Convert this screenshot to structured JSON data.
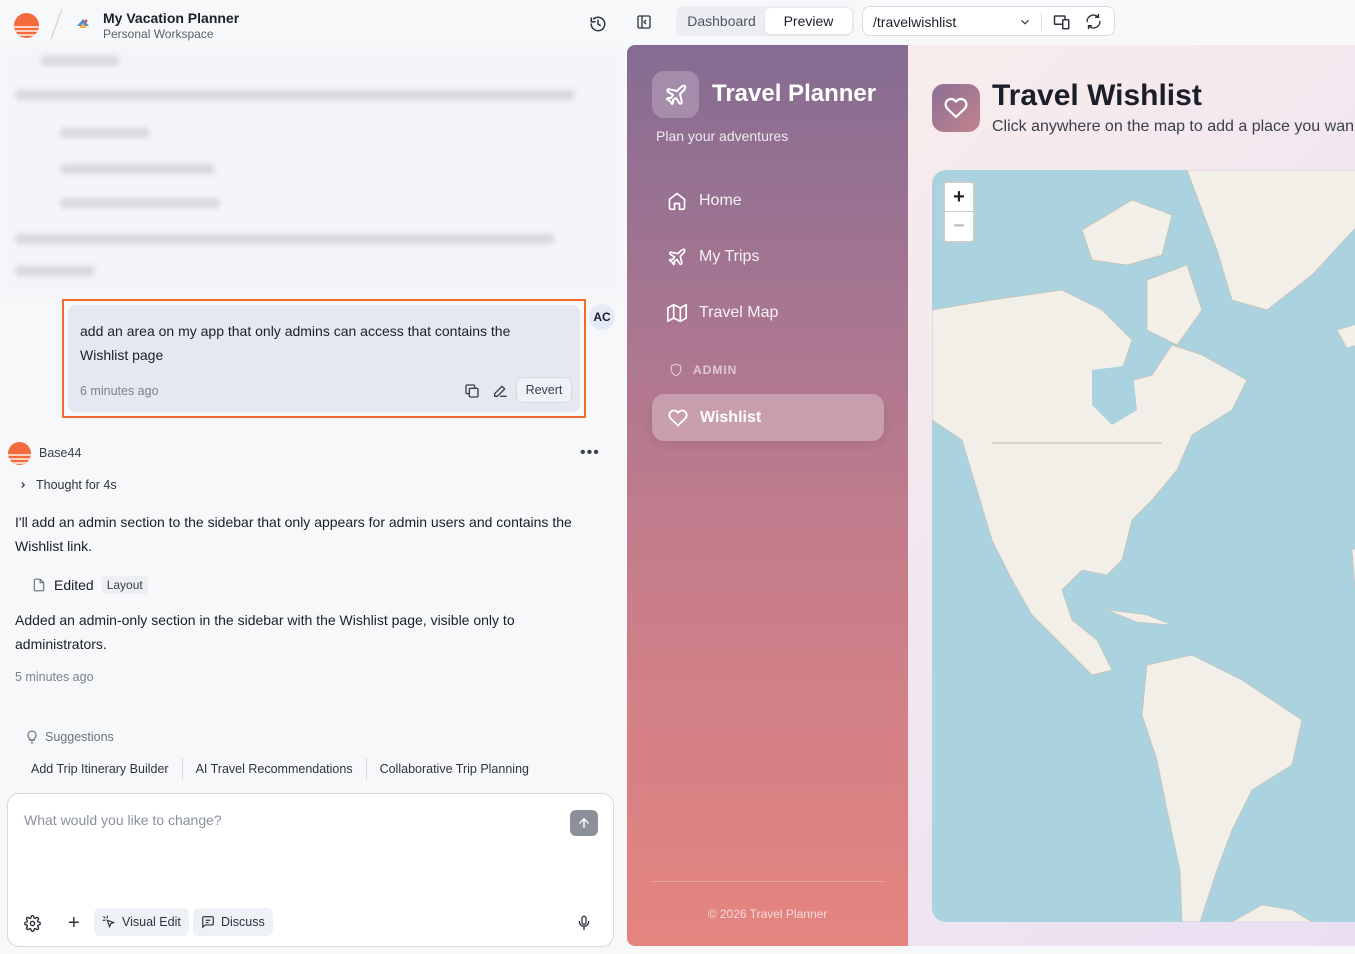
{
  "header": {
    "project_name": "My Vacation Planner",
    "workspace": "Personal Workspace",
    "view_tabs": [
      {
        "label": "Dashboard",
        "active": false
      },
      {
        "label": "Preview",
        "active": true
      }
    ],
    "url_path": "/travelwishlist"
  },
  "chat": {
    "user_message": {
      "avatar_initials": "AC",
      "text": "add an area on my app that only admins can access that contains the Wishlist page",
      "time": "6 minutes ago",
      "revert_label": "Revert"
    },
    "bot_message": {
      "name": "Base44",
      "more_label": "•••",
      "thought_label": "Thought for 4s",
      "paragraph_1": "I'll add an admin section to the sidebar that only appears for admin users and contains the Wishlist link.",
      "edited_label": "Edited",
      "edited_file": "Layout",
      "paragraph_2": "Added an admin-only section in the sidebar with the Wishlist page, visible only to administrators.",
      "time": "5 minutes ago"
    },
    "suggestions": {
      "title": "Suggestions",
      "items": [
        "Add Trip Itinerary Builder",
        "AI Travel Recommendations",
        "Collaborative Trip Planning"
      ]
    },
    "composer": {
      "placeholder": "What would you like to change?",
      "visual_edit_label": "Visual Edit",
      "discuss_label": "Discuss"
    }
  },
  "preview": {
    "sidebar": {
      "app_title": "Travel Planner",
      "app_subtitle": "Plan your adventures",
      "nav": [
        {
          "label": "Home",
          "icon": "home-icon"
        },
        {
          "label": "My Trips",
          "icon": "plane-icon"
        },
        {
          "label": "Travel Map",
          "icon": "map-icon"
        }
      ],
      "admin_section_label": "ADMIN",
      "active_item": "Wishlist",
      "footer": "© 2026 Travel Planner"
    },
    "main": {
      "title": "Travel Wishlist",
      "subtitle": "Click anywhere on the map to add a place you wan",
      "zoom_in": "+",
      "zoom_out": "−"
    }
  },
  "colors": {
    "highlight_border": "#ef6a2e",
    "sidebar_top": "#856c92",
    "sidebar_bottom": "#e5847f",
    "map_water": "#aad3df",
    "map_land": "#f2efe9"
  }
}
